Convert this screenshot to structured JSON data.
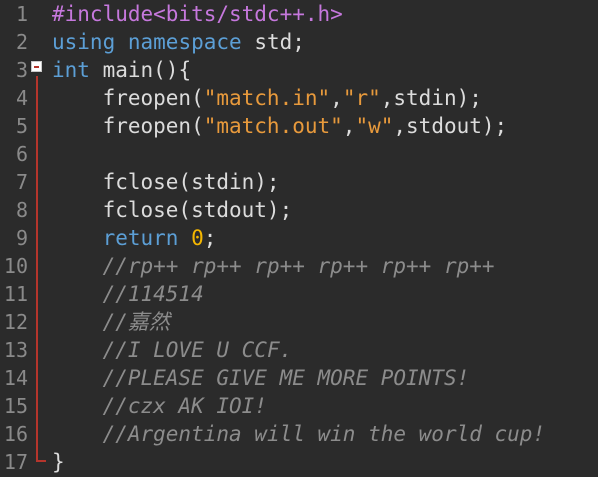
{
  "editor": {
    "line_numbers": [
      "1",
      "2",
      "3",
      "4",
      "5",
      "6",
      "7",
      "8",
      "9",
      "10",
      "11",
      "12",
      "13",
      "14",
      "15",
      "16",
      "17"
    ],
    "lines": [
      {
        "tokens": [
          {
            "t": "pre",
            "v": "#include<bits/stdc++.h>"
          }
        ]
      },
      {
        "tokens": [
          {
            "t": "kw",
            "v": "using"
          },
          {
            "t": "def",
            "v": " "
          },
          {
            "t": "kw",
            "v": "namespace"
          },
          {
            "t": "def",
            "v": " std;"
          }
        ]
      },
      {
        "tokens": [
          {
            "t": "kw",
            "v": "int"
          },
          {
            "t": "def",
            "v": " main(){"
          }
        ]
      },
      {
        "tokens": [
          {
            "t": "def",
            "v": "    freopen("
          },
          {
            "t": "str",
            "v": "\"match.in\""
          },
          {
            "t": "def",
            "v": ","
          },
          {
            "t": "str",
            "v": "\"r\""
          },
          {
            "t": "def",
            "v": ",stdin);"
          }
        ]
      },
      {
        "tokens": [
          {
            "t": "def",
            "v": "    freopen("
          },
          {
            "t": "str",
            "v": "\"match.out\""
          },
          {
            "t": "def",
            "v": ","
          },
          {
            "t": "str",
            "v": "\"w\""
          },
          {
            "t": "def",
            "v": ",stdout);"
          }
        ]
      },
      {
        "tokens": []
      },
      {
        "tokens": [
          {
            "t": "def",
            "v": "    fclose(stdin);"
          }
        ]
      },
      {
        "tokens": [
          {
            "t": "def",
            "v": "    fclose(stdout);"
          }
        ]
      },
      {
        "tokens": [
          {
            "t": "def",
            "v": "    "
          },
          {
            "t": "kw",
            "v": "return"
          },
          {
            "t": "def",
            "v": " "
          },
          {
            "t": "num",
            "v": "0"
          },
          {
            "t": "def",
            "v": ";"
          }
        ]
      },
      {
        "tokens": [
          {
            "t": "def",
            "v": "    "
          },
          {
            "t": "cmt",
            "v": "//rp++ rp++ rp++ rp++ rp++ rp++"
          }
        ]
      },
      {
        "tokens": [
          {
            "t": "def",
            "v": "    "
          },
          {
            "t": "cmt",
            "v": "//114514"
          }
        ]
      },
      {
        "tokens": [
          {
            "t": "def",
            "v": "    "
          },
          {
            "t": "cmt",
            "v": "//嘉然"
          }
        ]
      },
      {
        "tokens": [
          {
            "t": "def",
            "v": "    "
          },
          {
            "t": "cmt",
            "v": "//I LOVE U CCF."
          }
        ]
      },
      {
        "tokens": [
          {
            "t": "def",
            "v": "    "
          },
          {
            "t": "cmt",
            "v": "//PLEASE GIVE ME MORE POINTS!"
          }
        ]
      },
      {
        "tokens": [
          {
            "t": "def",
            "v": "    "
          },
          {
            "t": "cmt",
            "v": "//czx AK IOI!"
          }
        ]
      },
      {
        "tokens": [
          {
            "t": "def",
            "v": "    "
          },
          {
            "t": "cmt",
            "v": "//Argentina will win the world cup!"
          }
        ]
      },
      {
        "tokens": [
          {
            "t": "def",
            "v": "}"
          }
        ]
      }
    ]
  },
  "colors": {
    "background": "#2b2b2b",
    "preprocessor": "#c678dd",
    "keyword": "#5c9fd6",
    "string": "#e89a3c",
    "number": "#f5b700",
    "comment": "#8c8c8c",
    "fold_marker": "#b5352c"
  },
  "icons": {
    "fold": "fold-collapse-icon"
  }
}
